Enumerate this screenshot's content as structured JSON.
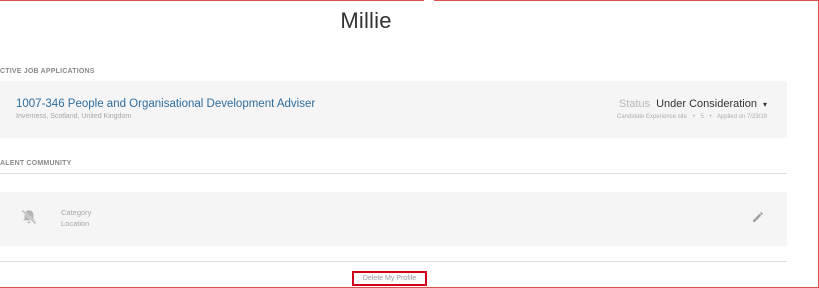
{
  "profile": {
    "name": "Millie"
  },
  "sections": {
    "active_applications": "CTIVE JOB APPLICATIONS",
    "talent_community": "ALENT COMMUNITY"
  },
  "application": {
    "title": "1007-346 People and Organisational Development Adviser",
    "location": "Inverness, Scotland, United Kingdom",
    "status_label": "Status",
    "status_value": "Under Consideration",
    "status_caret": "▾",
    "meta_site": "Candidate Experience site",
    "meta_number": "5",
    "meta_applied": "Applied on 7/23/19",
    "meta_separator": "•"
  },
  "community": {
    "category": "Category",
    "location": "Location"
  },
  "actions": {
    "delete_profile": "Delete My Profile"
  },
  "icons": {
    "bell": "notifications-off-icon",
    "edit": "pencil-icon",
    "status": "chevron-down-icon"
  },
  "colors": {
    "link": "#2f6d9e",
    "card_bg": "#f5f5f5",
    "highlight": "#d0021b"
  }
}
